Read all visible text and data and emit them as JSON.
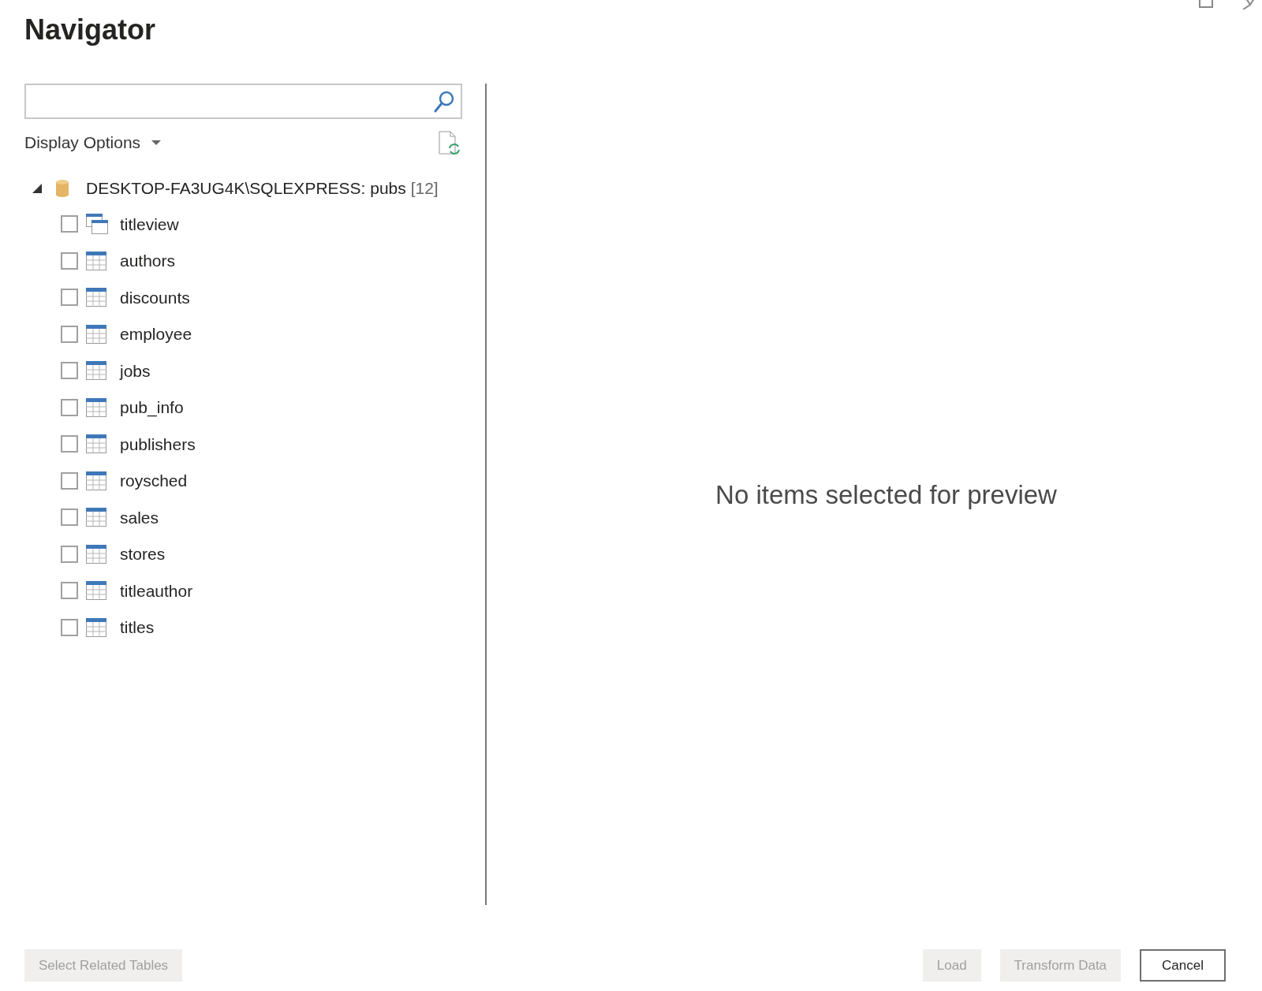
{
  "window": {
    "title": "Navigator"
  },
  "display_options": {
    "label": "Display Options"
  },
  "tree": {
    "label": "DESKTOP-FA3UG4K\\SQLEXPRESS: pubs",
    "count": "[12]",
    "expanded": true,
    "children": [
      {
        "label": "titleview",
        "kind": "view",
        "checked": false
      },
      {
        "label": "authors",
        "kind": "table",
        "checked": false
      },
      {
        "label": "discounts",
        "kind": "table",
        "checked": false
      },
      {
        "label": "employee",
        "kind": "table",
        "checked": false
      },
      {
        "label": "jobs",
        "kind": "table",
        "checked": false
      },
      {
        "label": "pub_info",
        "kind": "table",
        "checked": false
      },
      {
        "label": "publishers",
        "kind": "table",
        "checked": false
      },
      {
        "label": "roysched",
        "kind": "table",
        "checked": false
      },
      {
        "label": "sales",
        "kind": "table",
        "checked": false
      },
      {
        "label": "stores",
        "kind": "table",
        "checked": false
      },
      {
        "label": "titleauthor",
        "kind": "table",
        "checked": false
      },
      {
        "label": "titles",
        "kind": "table",
        "checked": false
      }
    ]
  },
  "preview": {
    "message": "No items selected for preview"
  },
  "footer": {
    "left_buttons": [
      {
        "label": "Select Related Tables",
        "disabled": true
      }
    ],
    "right_buttons": [
      {
        "label": "Load",
        "disabled": true
      },
      {
        "label": "Transform Data",
        "disabled": true
      },
      {
        "label": "Cancel",
        "disabled": false
      }
    ]
  }
}
